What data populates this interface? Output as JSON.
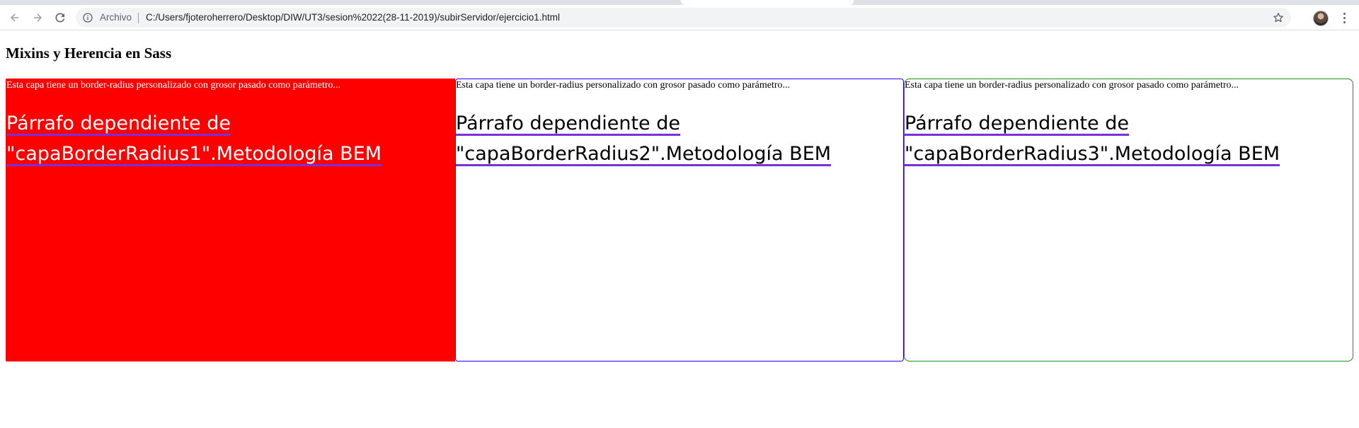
{
  "browser": {
    "scheme_chip": "Archivo",
    "url": "C:/Users/fjoteroherrero/Desktop/DIW/UT3/sesion%2022(28-11-2019)/subirServidor/ejercicio1.html"
  },
  "page": {
    "title": "Mixins y Herencia en Sass",
    "boxes": [
      {
        "description": "Esta capa tiene un border-radius personalizado con grosor pasado como parámetro...",
        "link": "Párrafo dependiente de \"capaBorderRadius1\".Metodología BEM",
        "background": "#ff0000",
        "border": "#ff0000"
      },
      {
        "description": "Esta capa tiene un border-radius personalizado con grosor pasado como parámetro...",
        "link": "Párrafo dependiente de \"capaBorderRadius2\".Metodología BEM",
        "background": "#ffffff",
        "border": "#2200ff"
      },
      {
        "description": "Esta capa tiene un border-radius personalizado con grosor pasado como parámetro...",
        "link": "Párrafo dependiente de \"capaBorderRadius3\".Metodología BEM",
        "background": "#ffffff",
        "border": "#1f8f1f"
      }
    ]
  },
  "colors": {
    "link_underline": "#7b2fd6"
  },
  "icons": [
    "back-arrow-icon",
    "forward-arrow-icon",
    "reload-icon",
    "info-icon",
    "star-icon",
    "more-menu-icon"
  ]
}
